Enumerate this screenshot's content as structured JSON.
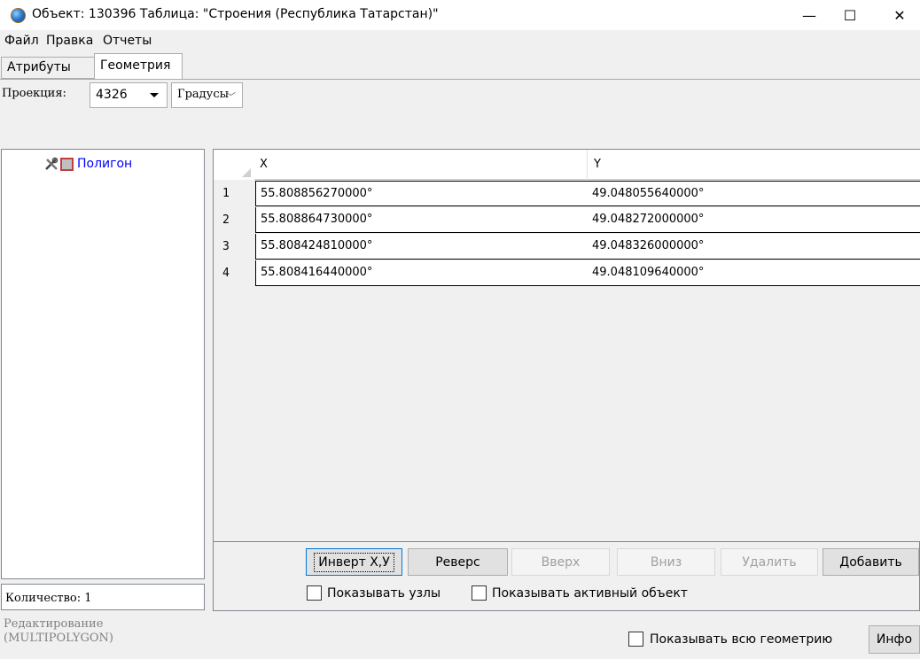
{
  "window": {
    "title": "Объект: 130396 Таблица: \"Строения (Республика Татарстан)\"",
    "minimize_label": "—",
    "maximize_label": "☐",
    "close_label": "✕"
  },
  "menu": {
    "items": [
      "Файл",
      "Правка",
      "Отчеты"
    ]
  },
  "tabs": [
    {
      "label": "Атрибуты",
      "active": false
    },
    {
      "label": "Геометрия",
      "active": true
    }
  ],
  "toolbar": {
    "projection_label": "Проекция:",
    "projection_value": "4326",
    "units_value": "Градусы"
  },
  "tree": {
    "items": [
      {
        "label": "Полигон",
        "icons": [
          "tools-icon",
          "polygon-swatch-icon"
        ]
      }
    ],
    "count_label": "Количество: 1"
  },
  "grid": {
    "columns": [
      "X",
      "Y"
    ],
    "rows": [
      {
        "num": "1",
        "x": "55.808856270000°",
        "y": "49.048055640000°"
      },
      {
        "num": "2",
        "x": "55.808864730000°",
        "y": "49.048272000000°"
      },
      {
        "num": "3",
        "x": "55.808424810000°",
        "y": "49.048326000000°"
      },
      {
        "num": "4",
        "x": "55.808416440000°",
        "y": "49.048109640000°"
      }
    ]
  },
  "actions": {
    "invert_label": "Инверт X,У",
    "reverse_label": "Реверс",
    "up_label": "Вверх",
    "down_label": "Вниз",
    "delete_label": "Удалить",
    "add_label": "Добавить",
    "show_nodes_label": "Показывать узлы",
    "show_active_label": "Показывать активный объект"
  },
  "status": {
    "mode_line1": "Редактирование",
    "mode_line2": "(MULTIPOLYGON)",
    "show_all_label": "Показывать всю геометрию",
    "info_label": "Инфо"
  },
  "colors": {
    "tree_label": "#0000ff",
    "disabled_text": "#a0a0a0",
    "focus_border": "#0078d7"
  }
}
